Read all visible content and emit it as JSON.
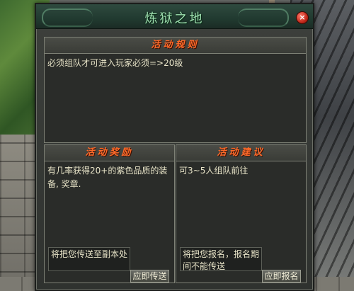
{
  "window": {
    "title": "炼狱之地",
    "close_label": "×"
  },
  "rules": {
    "header": "活动规则",
    "text": "必须组队才可进入玩家必须=>20级"
  },
  "rewards": {
    "header": "活动奖励",
    "text": "有几率获得20+的紫色品质的装备, 奖章.",
    "info_text": "将把您传送至副本处",
    "button_label": "应即传送"
  },
  "advice": {
    "header": "活动建议",
    "text": "可3~5人组队前往",
    "info_text": "将把您报名，报名期间不能传送",
    "button_label": "应即报名"
  }
}
